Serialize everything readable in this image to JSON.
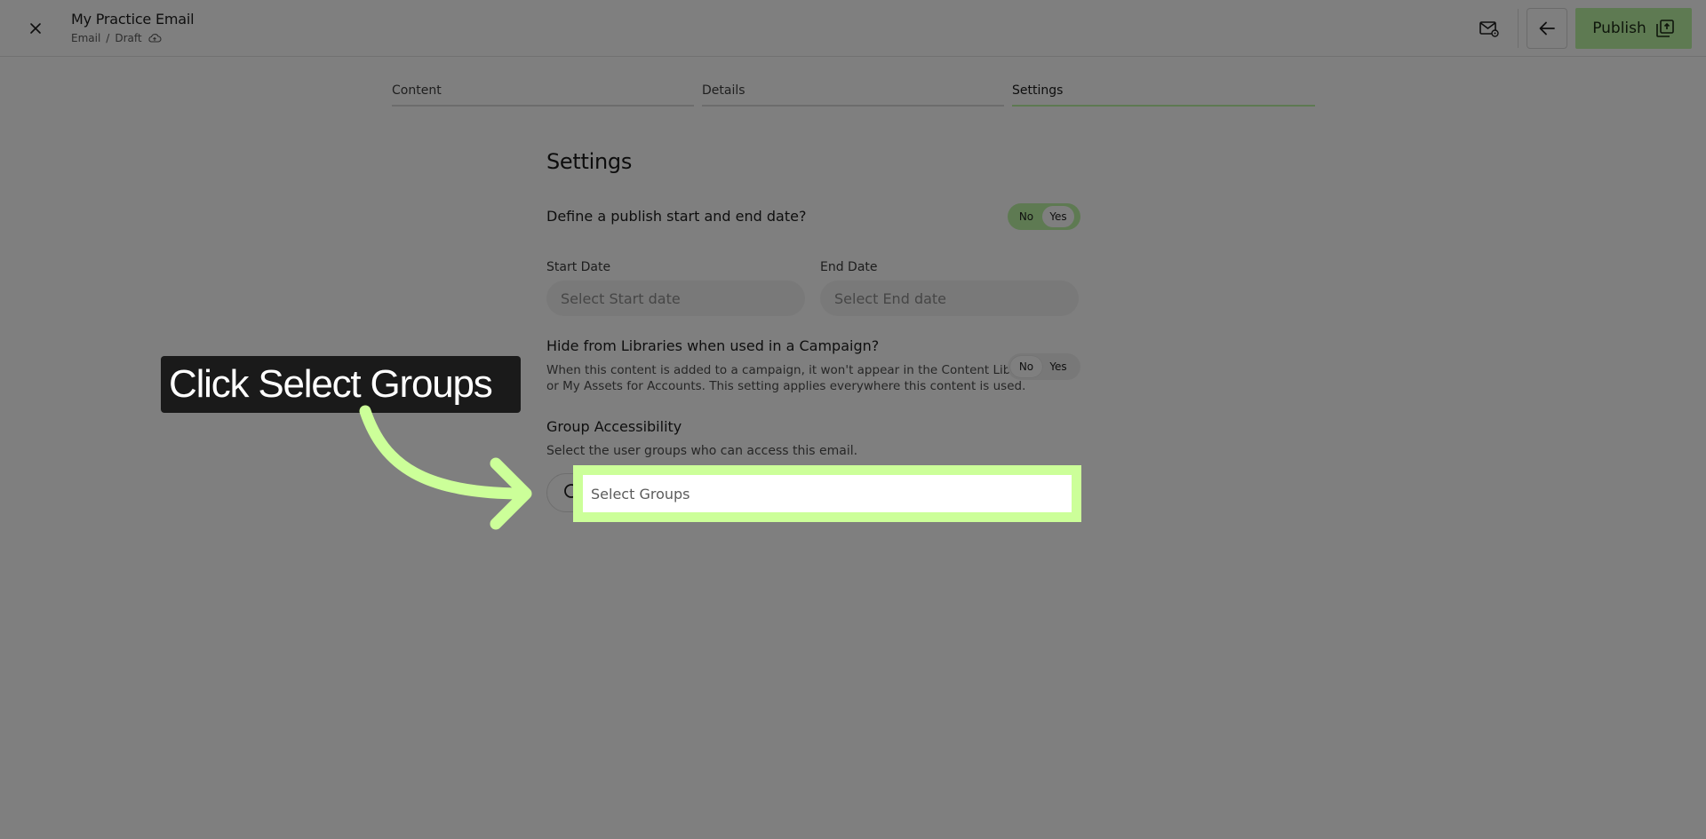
{
  "header": {
    "title": "My Practice Email",
    "breadcrumb": [
      "Email",
      "/",
      "Draft"
    ],
    "publish_label": "Publish"
  },
  "tabs": [
    {
      "label": "Content",
      "active": false
    },
    {
      "label": "Details",
      "active": false
    },
    {
      "label": "Settings",
      "active": true
    }
  ],
  "settings": {
    "heading": "Settings",
    "publish_dates": {
      "question": "Define a publish start and end date?",
      "toggle": {
        "no": "No",
        "yes": "Yes",
        "selected": "Yes"
      },
      "start_label": "Start Date",
      "start_placeholder": "Select Start date",
      "end_label": "End Date",
      "end_placeholder": "Select End date"
    },
    "hide_from_libraries": {
      "question": "Hide from Libraries when used in a Campaign?",
      "description_line1": "When this content is added to a campaign, it won't appear in the Content Library",
      "description_line2": "or My Assets for Accounts. This setting applies everywhere this content is used.",
      "toggle": {
        "no": "No",
        "yes": "Yes",
        "selected": "No"
      }
    },
    "group_accessibility": {
      "heading": "Group Accessibility",
      "hint": "Select the user groups who can access this email.",
      "placeholder": "Select Groups"
    }
  },
  "overlay": {
    "callout_text": "Click Select Groups",
    "highlight_color": "#ccff99"
  },
  "colors": {
    "accent": "#bdf5a4",
    "dim": "rgba(0,0,0,0.5)"
  }
}
